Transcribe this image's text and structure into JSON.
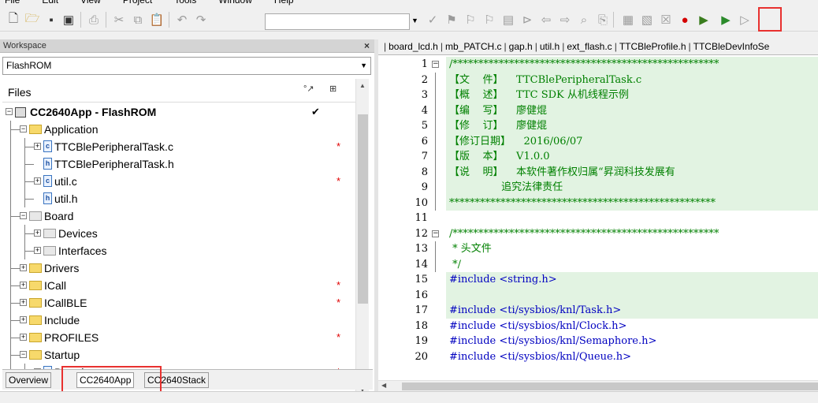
{
  "menubar": {
    "items": [
      "File",
      "Edit",
      "View",
      "Project",
      "Tools",
      "Window",
      "Help"
    ]
  },
  "toolbar": {
    "left_icons": [
      "new-file-icon",
      "open-folder-icon",
      "save-icon",
      "save-all-icon",
      "print-icon",
      "cut-icon",
      "copy-icon",
      "paste-icon",
      "undo-icon",
      "redo-icon"
    ],
    "right_icons": [
      "check-icon",
      "bookmark-icon",
      "bookmark-next-icon",
      "bookmark-prev-icon",
      "toggle-view-icon",
      "navigate-back-icon",
      "navigate-forward-icon",
      "find-icon",
      "find-in-files-icon",
      "compile-icon",
      "make-icon",
      "rebuild-icon",
      "breakpoint-icon",
      "download-and-debug-icon",
      "debug-without-download-icon"
    ],
    "highlighted_icon": "download-and-debug-icon",
    "highlight_color": "#e8312f"
  },
  "workspace": {
    "title": "Workspace",
    "close": "×",
    "config": "FlashROM",
    "files_header": "Files",
    "tree": [
      {
        "label": "CC2640App - FlashROM",
        "type": "project",
        "expanded": true,
        "tick": "✔",
        "bold": true
      },
      {
        "label": "Application",
        "type": "folder",
        "expanded": true
      },
      {
        "label": "TTCBlePeripheralTask.c",
        "type": "c",
        "dot": "*"
      },
      {
        "label": "TTCBlePeripheralTask.h",
        "type": "h"
      },
      {
        "label": "util.c",
        "type": "c",
        "dot": "*"
      },
      {
        "label": "util.h",
        "type": "h"
      },
      {
        "label": "Board",
        "type": "gfolder",
        "expanded": true
      },
      {
        "label": "Devices",
        "type": "gfolder"
      },
      {
        "label": "Interfaces",
        "type": "gfolder"
      },
      {
        "label": "Drivers",
        "type": "folder"
      },
      {
        "label": "ICall",
        "type": "folder",
        "dot": "*"
      },
      {
        "label": "ICallBLE",
        "type": "folder",
        "dot": "*"
      },
      {
        "label": "Include",
        "type": "folder"
      },
      {
        "label": "PROFILES",
        "type": "folder",
        "dot": "*"
      },
      {
        "label": "Startup",
        "type": "folder",
        "expanded": true
      },
      {
        "label": "Board.c",
        "type": "c",
        "dot": "*"
      }
    ],
    "tabs": [
      "Overview",
      "CC2640App",
      "CC2640Stack"
    ],
    "active_tab": "CC2640App"
  },
  "editor": {
    "tabs": [
      "board_lcd.h",
      "mb_PATCH.c",
      "gap.h",
      "util.h",
      "ext_flash.c",
      "TTCBleProfile.h",
      "TTCBleDevInfoSe"
    ],
    "lines": [
      {
        "n": "1",
        "text": "/****************************************************",
        "cls": "green",
        "fold": "−"
      },
      {
        "n": "2",
        "text": "【文    件】    TTCBlePeripheralTask.c",
        "cls": "green"
      },
      {
        "n": "3",
        "text": "【概    述】    TTC SDK 从机线程示例",
        "cls": "green"
      },
      {
        "n": "4",
        "text": "【编    写】    廖健焜",
        "cls": "green"
      },
      {
        "n": "5",
        "text": "【修    订】    廖健焜",
        "cls": "green"
      },
      {
        "n": "6",
        "text": "【修订日期】    2016/06/07",
        "cls": "green"
      },
      {
        "n": "7",
        "text": "【版    本】    V1.0.0",
        "cls": "green"
      },
      {
        "n": "8",
        "text": "【说    明】    本软件著作权归属“昇润科技发展有",
        "cls": "green"
      },
      {
        "n": "9",
        "text": "                追究法律责任",
        "cls": "green"
      },
      {
        "n": "10",
        "text": "****************************************************",
        "cls": "green"
      },
      {
        "n": "11",
        "text": "",
        "cls": ""
      },
      {
        "n": "12",
        "text": "/****************************************************",
        "cls": "green",
        "fold": "−"
      },
      {
        "n": "13",
        "text": " * 头文件",
        "cls": "green"
      },
      {
        "n": "14",
        "text": " */",
        "cls": "green"
      },
      {
        "n": "15",
        "text": "#include <string.h>",
        "cls": "blue"
      },
      {
        "n": "16",
        "text": "",
        "cls": ""
      },
      {
        "n": "17",
        "text": "#include <ti/sysbios/knl/Task.h>",
        "cls": "blue"
      },
      {
        "n": "18",
        "text": "#include <ti/sysbios/knl/Clock.h>",
        "cls": "blue"
      },
      {
        "n": "19",
        "text": "#include <ti/sysbios/knl/Semaphore.h>",
        "cls": "blue"
      },
      {
        "n": "20",
        "text": "#include <ti/sysbios/knl/Queue.h>",
        "cls": "blue"
      }
    ]
  }
}
